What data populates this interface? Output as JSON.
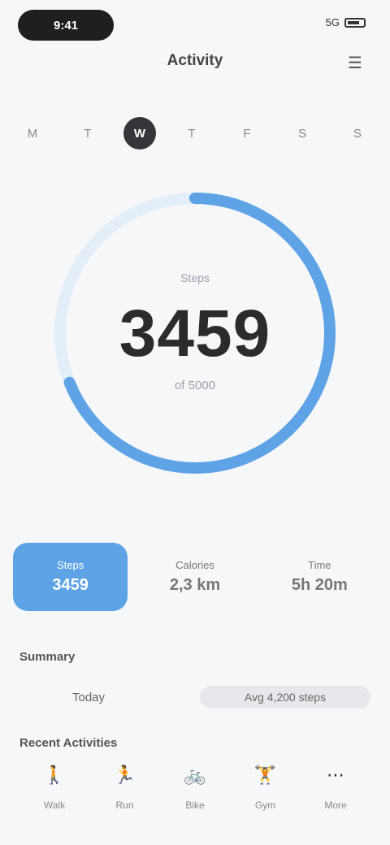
{
  "status": {
    "time": "9:41",
    "signal": "5G"
  },
  "header": {
    "title": "Activity"
  },
  "week": [
    "M",
    "T",
    "W",
    "T",
    "F",
    "S",
    "S"
  ],
  "active_day_index": 2,
  "ring": {
    "label": "Steps",
    "value": "3459",
    "unit": "of 5000",
    "progress_fraction": 0.69,
    "color": "#5ea3e6"
  },
  "tabs": [
    {
      "title": "Steps",
      "value": "3459"
    },
    {
      "title": "Calories",
      "value": "2,3 km"
    },
    {
      "title": "Time",
      "value": "5h 20m"
    }
  ],
  "active_tab_index": 0,
  "summary": {
    "title": "Summary",
    "left": "Today",
    "right": "Avg 4,200 steps"
  },
  "activities": {
    "title": "Recent Activities",
    "items": [
      {
        "icon": "walk-icon",
        "label": "Walk"
      },
      {
        "icon": "run-icon",
        "label": "Run"
      },
      {
        "icon": "bike-icon",
        "label": "Bike"
      },
      {
        "icon": "gym-icon",
        "label": "Gym"
      },
      {
        "icon": "more-icon",
        "label": "More"
      }
    ]
  }
}
